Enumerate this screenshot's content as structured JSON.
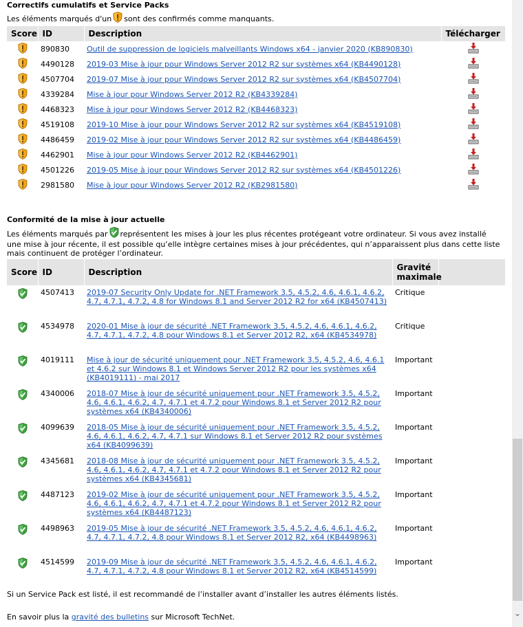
{
  "section1": {
    "title": "Correctifs cumulatifs et Service Packs",
    "note_before": "Les éléments marqués d'un",
    "note_after": "sont des confirmés comme manquants.",
    "headers": {
      "score": "Score",
      "id": "ID",
      "description": "Description",
      "download": "Télécharger"
    },
    "rows": [
      {
        "id": "890830",
        "description": "Outil de suppression de logiciels malveillants Windows x64 - janvier 2020 (KB890830)"
      },
      {
        "id": "4490128",
        "description": "2019-03 Mise à jour pour Windows Server 2012 R2 sur systèmes x64 (KB4490128)"
      },
      {
        "id": "4507704",
        "description": "2019-07 Mise à jour pour Windows Server 2012 R2 sur systèmes x64 (KB4507704)"
      },
      {
        "id": "4339284",
        "description": "Mise à jour pour Windows Server 2012 R2 (KB4339284)"
      },
      {
        "id": "4468323",
        "description": "Mise à jour pour Windows Server 2012 R2 (KB4468323)"
      },
      {
        "id": "4519108",
        "description": "2019-10 Mise à jour pour Windows Server 2012 R2 sur systèmes x64 (KB4519108)"
      },
      {
        "id": "4486459",
        "description": "2019-02 Mise à jour pour Windows Server 2012 R2 sur systèmes x64 (KB4486459)"
      },
      {
        "id": "4462901",
        "description": "Mise à jour pour Windows Server 2012 R2 (KB4462901)"
      },
      {
        "id": "4501226",
        "description": "2019-05 Mise à jour pour Windows Server 2012 R2 sur systèmes x64 (KB4501226)"
      },
      {
        "id": "2981580",
        "description": "Mise à jour pour Windows Server 2012 R2 (KB2981580)"
      }
    ]
  },
  "section2": {
    "title": "Conformité de la mise à jour actuelle",
    "note_before": "Les éléments marqués par",
    "note_after": "représentent les mises à jour les plus récentes protégeant votre ordinateur. Si vous avez installé une mise à jour récente, il est possible qu’elle intègre certaines mises à jour précédentes, qui n’apparaissent plus dans cette liste mais continuent de protéger l’ordinateur.",
    "headers": {
      "score": "Score",
      "id": "ID",
      "description": "Description",
      "severity_line1": "Gravité",
      "severity_line2": "maximale"
    },
    "rows": [
      {
        "id": "4507413",
        "description": "2019-07 Security Only Update for .NET Framework 3.5, 4.5.2, 4.6, 4.6.1, 4.6.2, 4.7, 4.7.1, 4.7.2, 4.8 for Windows 8.1 and Server 2012 R2 for x64 (KB4507413)",
        "severity": "Critique"
      },
      {
        "id": "4534978",
        "description": "2020-01 Mise à jour de sécurité .NET Framework 3.5, 4.5.2, 4.6, 4.6.1, 4.6.2, 4.7, 4.7.1, 4.7.2, 4.8 pour Windows 8.1 et Server 2012 R2, x64 (KB4534978)",
        "severity": "Critique"
      },
      {
        "id": "4019111",
        "description": "Mise à jour de sécurité uniquement pour .NET Framework 3.5, 4.5.2, 4.6, 4.6.1 et 4.6.2 sur Windows 8.1 et Windows Server 2012 R2 pour les systèmes x64 (KB4019111) - mai 2017",
        "severity": "Important"
      },
      {
        "id": "4340006",
        "description": "2018-07 Mise à jour de sécurité uniquement pour .NET Framework 3.5, 4.5.2, 4.6, 4.6.1, 4.6.2, 4.7, 4.7.1 et 4.7.2 pour Windows 8.1 et Server 2012 R2 pour systèmes x64 (KB4340006)",
        "severity": "Important"
      },
      {
        "id": "4099639",
        "description": "2018-05 Mise à jour de sécurité uniquement pour .NET Framework 3.5, 4.5.2, 4.6, 4.6.1, 4.6.2, 4.7, 4.7.1 sur Windows 8.1 et Server 2012 R2 pour systèmes x64 (KB4099639)",
        "severity": "Important"
      },
      {
        "id": "4345681",
        "description": "2018-08 Mise à jour de sécurité uniquement pour .NET Framework 3.5, 4.5.2, 4.6, 4.6.1, 4.6.2, 4.7, 4.7.1 et 4.7.2 pour Windows 8.1 et Server 2012 R2 pour systèmes x64 (KB4345681)",
        "severity": "Important"
      },
      {
        "id": "4487123",
        "description": "2019-02 Mise à jour de sécurité uniquement pour .NET Framework 3.5, 4.5.2, 4.6, 4.6.1, 4.6.2, 4.7, 4.7.1 et 4.7.2 pour Windows 8.1 et Server 2012 R2 pour systèmes x64 (KB4487123)",
        "severity": "Important"
      },
      {
        "id": "4498963",
        "description": "2019-05 Mise à jour de sécurité .NET Framework 3.5, 4.5.2, 4.6, 4.6.1, 4.6.2, 4.7, 4.7.1, 4.7.2, 4.8 pour Windows 8.1 et Server 2012 R2, x64 (KB4498963)",
        "severity": "Important"
      },
      {
        "id": "4514599",
        "description": "2019-09 Mise à jour de sécurité .NET Framework 3.5, 4.5.2, 4.6, 4.6.1, 4.6.2, 4.7, 4.7.1, 4.7.2, 4.8 pour Windows 8.1 et Server 2012 R2, x64 (KB4514599)",
        "severity": "Important"
      }
    ]
  },
  "footer": {
    "service_pack_note": "Si un Service Pack est listé, il est recommandé de l’installer avant d’installer les autres éléments listés.",
    "learn_before": "En savoir plus la",
    "learn_link": "gravité des bulletins",
    "learn_after": "sur Microsoft TechNet."
  },
  "icons": {
    "missing": "warning-shield-icon",
    "compliant": "check-shield-icon",
    "download": "download-icon",
    "scroll_down": "scroll-down-arrow-icon"
  },
  "colors": {
    "link": "#1a54b4",
    "header_bg": "#e4e4e4",
    "warning": "#f0a020",
    "ok": "#3a9a3a"
  }
}
